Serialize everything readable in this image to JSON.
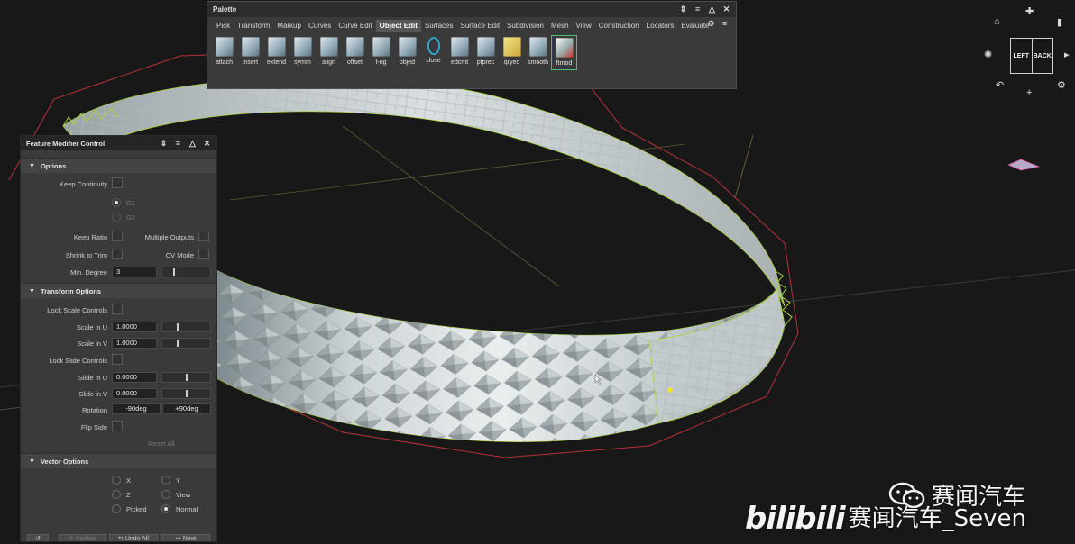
{
  "palette": {
    "title": "Palette",
    "tabs": [
      "Pick",
      "Transform",
      "Markup",
      "Curves",
      "Curve Edit",
      "Object Edit",
      "Surfaces",
      "Surface Edit",
      "Subdivision",
      "Mesh",
      "View",
      "Construction",
      "Locators",
      "Evaluate"
    ],
    "active_tab": "Object Edit",
    "tools": [
      "attach",
      "insert",
      "extend",
      "symm",
      "align",
      "offset",
      "t-rig",
      "objed",
      "close",
      "edcmt",
      "ptprec",
      "qryed",
      "smooth",
      "ftmod"
    ],
    "selected_tool": "ftmod"
  },
  "fmc": {
    "title": "Feature Modifier Control",
    "options": {
      "header": "Options",
      "keep_continuity": "Keep Continuity",
      "g1": "G1",
      "g2": "G2",
      "keep_ratio": "Keep Ratio",
      "multiple_outputs": "Multiple Outputs",
      "shrink_to_trim": "Shrink to Trim",
      "cv_mode": "CV Mode",
      "min_degree_label": "Min. Degree",
      "min_degree_value": "3"
    },
    "transform": {
      "header": "Transform Options",
      "lock_scale": "Lock Scale Controls",
      "scale_u_label": "Scale in U",
      "scale_u_value": "1.0000",
      "scale_v_label": "Scale in V",
      "scale_v_value": "1.0000",
      "lock_slide": "Lock Slide Controls",
      "slide_u_label": "Slide in U",
      "slide_u_value": "0.0000",
      "slide_v_label": "Slide in V",
      "slide_v_value": "0.0000",
      "rotation_label": "Rotation",
      "rotation_min": "-90deg",
      "rotation_max": "+90deg",
      "flip_side": "Flip Side",
      "reset_all": "Reset All"
    },
    "vector": {
      "header": "Vector Options",
      "x": "X",
      "y": "Y",
      "z": "Z",
      "view": "View",
      "picked": "Picked",
      "normal": "Normal",
      "selected": "Normal"
    },
    "footer": {
      "update": "Update",
      "undo_all": "Undo All",
      "next": "Next"
    }
  },
  "viewcube": {
    "left": "LEFT",
    "back": "BACK"
  },
  "watermark": {
    "wechat": "赛闻汽车",
    "bilibili_logo": "bilibili",
    "channel": "赛闻汽车_Seven"
  },
  "colors": {
    "accent_green": "#4dbf6d",
    "model_edge": "#a8d23a",
    "bbox_red": "#b5333a",
    "yellow_point": "#f4ea1d"
  }
}
